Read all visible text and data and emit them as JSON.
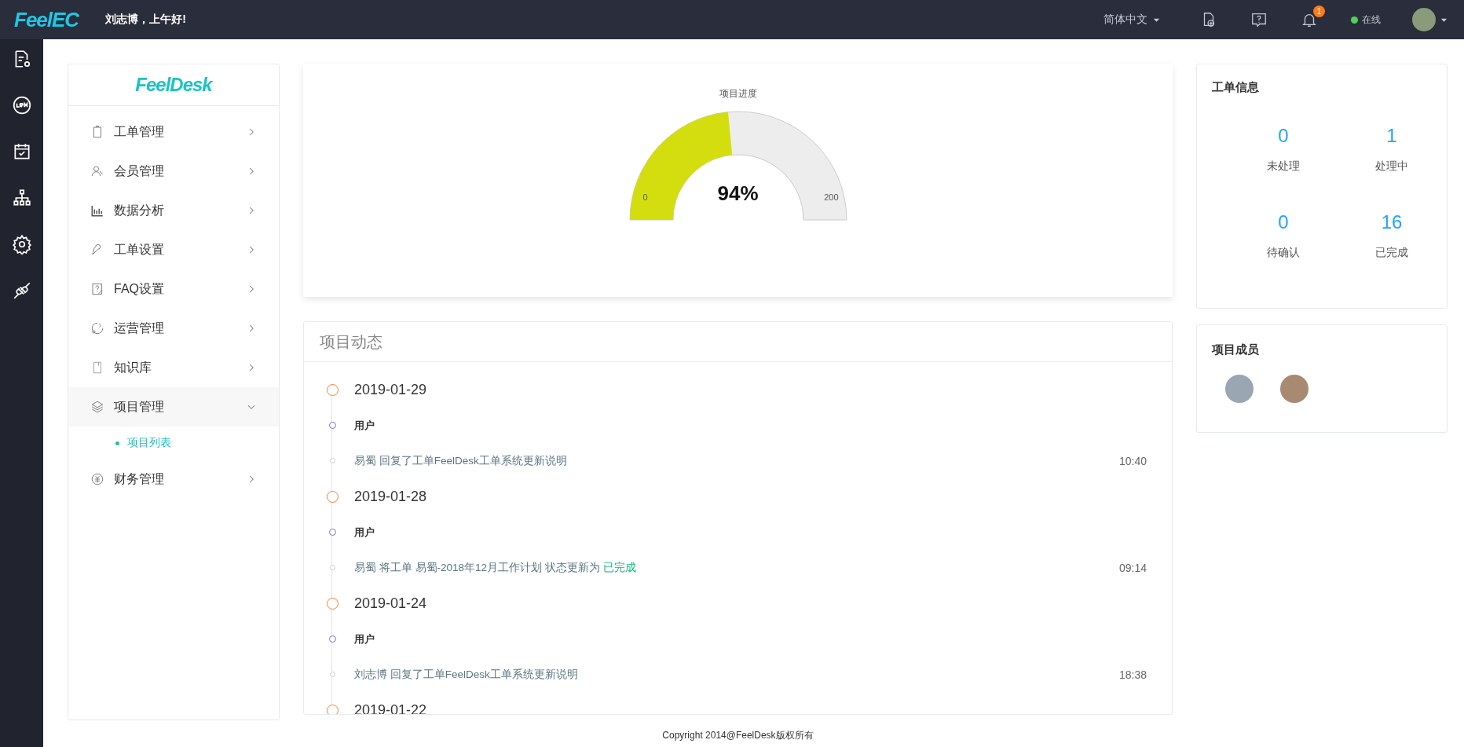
{
  "topbar": {
    "logo": "FeelEC",
    "greeting": "刘志博，上午好!",
    "language": "简体中文",
    "notification_count": "1",
    "status": "在线"
  },
  "side_menu": {
    "logo": "FeelDesk",
    "items": [
      {
        "label": "工单管理",
        "expanded": false
      },
      {
        "label": "会员管理",
        "expanded": false
      },
      {
        "label": "数据分析",
        "expanded": false
      },
      {
        "label": "工单设置",
        "expanded": false
      },
      {
        "label": "FAQ设置",
        "expanded": false
      },
      {
        "label": "运营管理",
        "expanded": false
      },
      {
        "label": "知识库",
        "expanded": false
      },
      {
        "label": "项目管理",
        "expanded": true,
        "children": [
          {
            "label": "项目列表",
            "selected": true
          }
        ]
      },
      {
        "label": "财务管理",
        "expanded": false
      }
    ]
  },
  "gauge": {
    "title": "项目进度",
    "level": 0.47,
    "reading": "94%",
    "min_label": "0",
    "max_label": "200"
  },
  "timeline": {
    "title": "项目动态",
    "days": [
      {
        "date": "2019-01-29",
        "groups": [
          {
            "label": "用户",
            "entries": [
              {
                "text": "易蜀 回复了工单FeelDesk工单系统更新说明",
                "time": "10:40"
              }
            ]
          }
        ]
      },
      {
        "date": "2019-01-28",
        "groups": [
          {
            "label": "用户",
            "entries": [
              {
                "text": "易蜀 将工单 易蜀-2018年12月工作计划 状态更新为",
                "status": "已完成",
                "time": "09:14"
              }
            ]
          }
        ]
      },
      {
        "date": "2019-01-24",
        "groups": [
          {
            "label": "用户",
            "entries": [
              {
                "text": "刘志博 回复了工单FeelDesk工单系统更新说明",
                "time": "18:38"
              }
            ]
          }
        ]
      },
      {
        "date": "2019-01-22"
      }
    ]
  },
  "ticket_info": {
    "title": "工单信息",
    "stats": [
      {
        "value": "0",
        "label": "未处理"
      },
      {
        "value": "1",
        "label": "处理中"
      },
      {
        "value": "0",
        "label": "待确认"
      },
      {
        "value": "16",
        "label": "已完成"
      }
    ]
  },
  "members": {
    "title": "项目成员",
    "avatars": [
      {
        "kind": "photo"
      },
      {
        "kind": "photo"
      }
    ]
  },
  "footer": "Copyright 2014@FeelDesk版权所有"
}
